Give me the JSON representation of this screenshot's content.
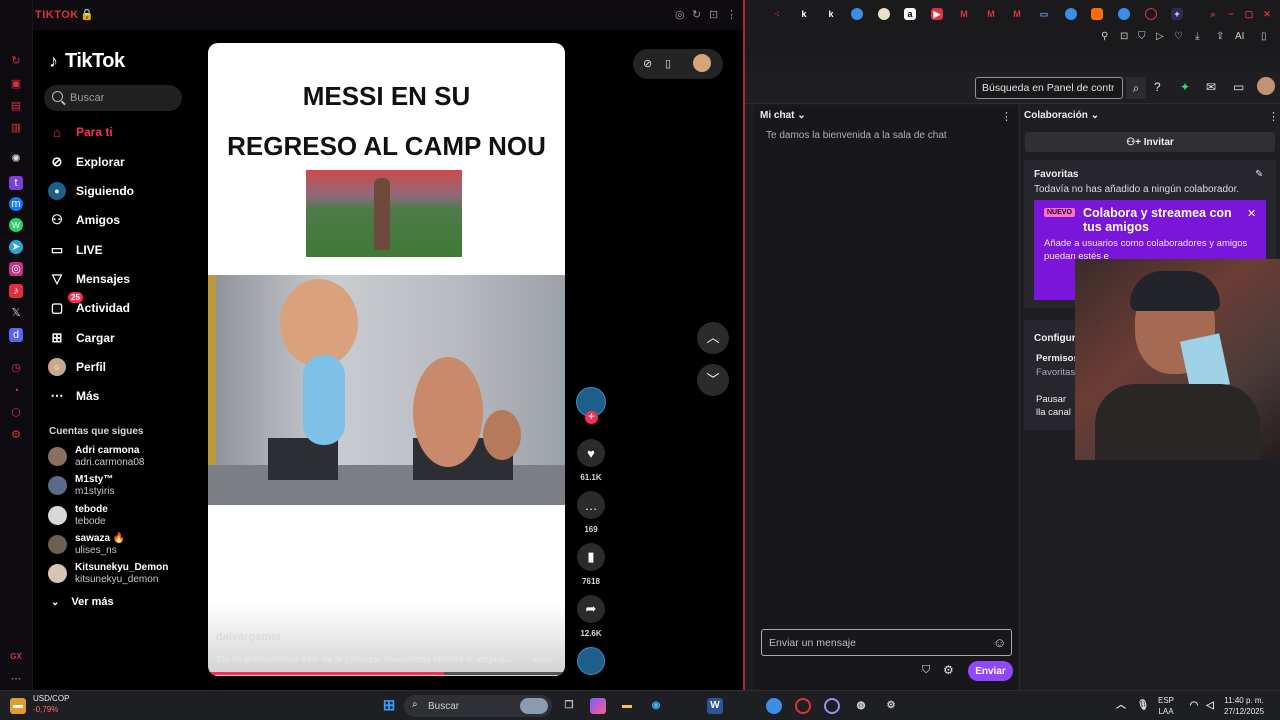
{
  "left_window": {
    "title": "TIKTOK",
    "sidebar_icons": [
      "refresh-icon",
      "twitch-icon",
      "messenger-icon",
      "whatsapp-icon",
      "telegram-icon",
      "instagram-icon",
      "tiktok-icon",
      "x-icon",
      "discord-icon",
      "history-icon",
      "clock-icon",
      "shield-icon",
      "settings-icon"
    ],
    "gx_label": "GX"
  },
  "tiktok": {
    "logo": "TikTok",
    "search_placeholder": "Buscar",
    "nav": [
      {
        "label": "Para ti",
        "icon": "home-icon",
        "active": true
      },
      {
        "label": "Explorar",
        "icon": "compass-icon"
      },
      {
        "label": "Siguiendo",
        "icon": "following-icon"
      },
      {
        "label": "Amigos",
        "icon": "friends-icon"
      },
      {
        "label": "LIVE",
        "icon": "live-icon"
      },
      {
        "label": "Mensajes",
        "icon": "messages-icon"
      },
      {
        "label": "Actividad",
        "icon": "activity-icon",
        "badge": "25"
      },
      {
        "label": "Cargar",
        "icon": "upload-icon"
      },
      {
        "label": "Perfil",
        "icon": "profile-icon"
      },
      {
        "label": "Más",
        "icon": "more-icon"
      }
    ],
    "following_title": "Cuentas que sigues",
    "following": [
      {
        "name": "Adri carmona",
        "handle": "adri.carmona08"
      },
      {
        "name": "M1sty™",
        "handle": "m1styiris"
      },
      {
        "name": "tebode",
        "handle": "tebode"
      },
      {
        "name": "sawaza 🔥",
        "handle": "ulises_ns"
      },
      {
        "name": "Kitsunekyu_Demon",
        "handle": "kitsunekyu_demon"
      }
    ],
    "see_more": "Ver más",
    "video": {
      "title_line1": "MESSI EN SU",
      "title_line2": "REGRESO AL CAMP NOU",
      "author": "daivargamer",
      "caption": "1% de probabilidad 99% de fe | #messi #barcelona #futbol #campno...",
      "more": "más",
      "progress": 0.66
    },
    "actions": {
      "likes": "61.1K",
      "comments": "169",
      "saves": "7618",
      "shares": "12.6K"
    }
  },
  "right_window": {
    "search_placeholder": "Búsqueda en Panel de control",
    "chat": {
      "header": "Mi chat",
      "welcome": "Te damos la bienvenida a la sala de chat",
      "input_placeholder": "Enviar un mensaje",
      "send": "Enviar"
    },
    "collab": {
      "header": "Colaboración",
      "invite": "Invitar",
      "favorites_title": "Favoritas",
      "favorites_empty": "Todavía no has añadido a ningún colaborador.",
      "promo_badge": "NUEVO",
      "promo_title": "Colabora y streamea con tus amigos",
      "promo_body": "Añade a usuarios como colaboradores y amigos puedan estés e",
      "config_title": "Configura",
      "permissions": "Permisos",
      "permissions_sub": "Favoritas",
      "pause": "Pausar lla canal"
    }
  },
  "taskbar": {
    "ticker_pair": "USD/COP",
    "ticker_change": "-0,79%",
    "search_placeholder": "Buscar",
    "lang_line1": "ESP",
    "lang_line2": "LAA",
    "time": "11:40 p. m.",
    "date": "27/12/2025"
  },
  "colors": {
    "tiktok_accent": "#fe2c55",
    "twitch_purple": "#9147ff",
    "opera_red": "#e0303e"
  }
}
